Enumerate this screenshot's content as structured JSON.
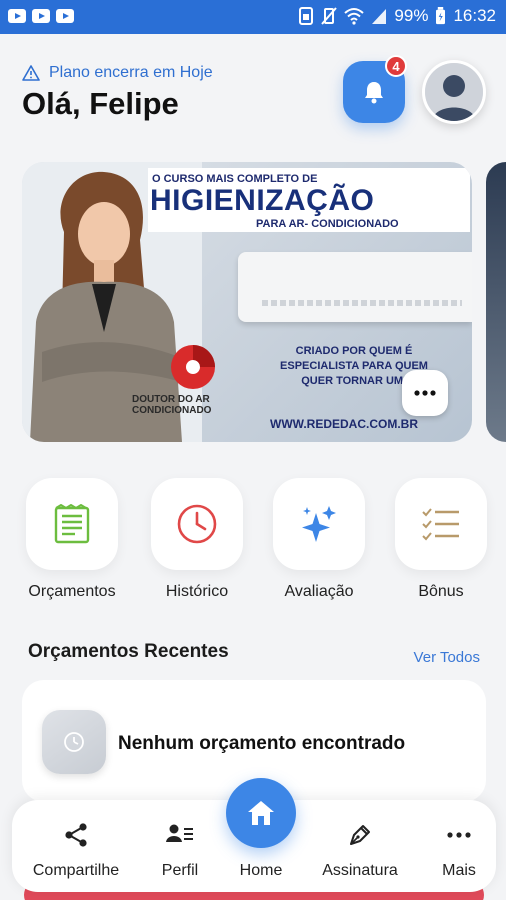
{
  "status_bar": {
    "battery": "99%",
    "time": "16:32"
  },
  "header": {
    "plan_notice": "Plano encerra em Hoje",
    "greeting": "Olá, Felipe",
    "notification_count": "4"
  },
  "banner": {
    "kicker": "O CURSO MAIS COMPLETO DE",
    "title": "HIGIENIZAÇÃO",
    "subtitle": "PARA AR- CONDICIONADO",
    "claim": "CRIADO POR QUEM É ESPECIALISTA PARA QUEM QUER TORNAR UM!",
    "url": "WWW.REDEDAC.COM.BR",
    "brand": "DOUTOR DO AR CONDICIONADO"
  },
  "quick_actions": [
    {
      "label": "Orçamentos",
      "icon": "document-icon"
    },
    {
      "label": "Histórico",
      "icon": "clock-icon"
    },
    {
      "label": "Avaliação",
      "icon": "sparkle-icon"
    },
    {
      "label": "Bônus",
      "icon": "checklist-icon"
    }
  ],
  "recent": {
    "title": "Orçamentos Recentes",
    "see_all": "Ver Todos",
    "empty_message": "Nenhum orçamento encontrado"
  },
  "bottom_nav": [
    {
      "label": "Compartilhe",
      "icon": "share-icon"
    },
    {
      "label": "Perfil",
      "icon": "profile-card-icon"
    },
    {
      "label": "Home",
      "icon": "home-icon"
    },
    {
      "label": "Assinatura",
      "icon": "pen-icon"
    },
    {
      "label": "Mais",
      "icon": "more-icon"
    }
  ],
  "colors": {
    "primary": "#3d86e6",
    "status_bar": "#2a6fd6",
    "badge": "#e03b3b",
    "background": "#f3f4f6"
  }
}
